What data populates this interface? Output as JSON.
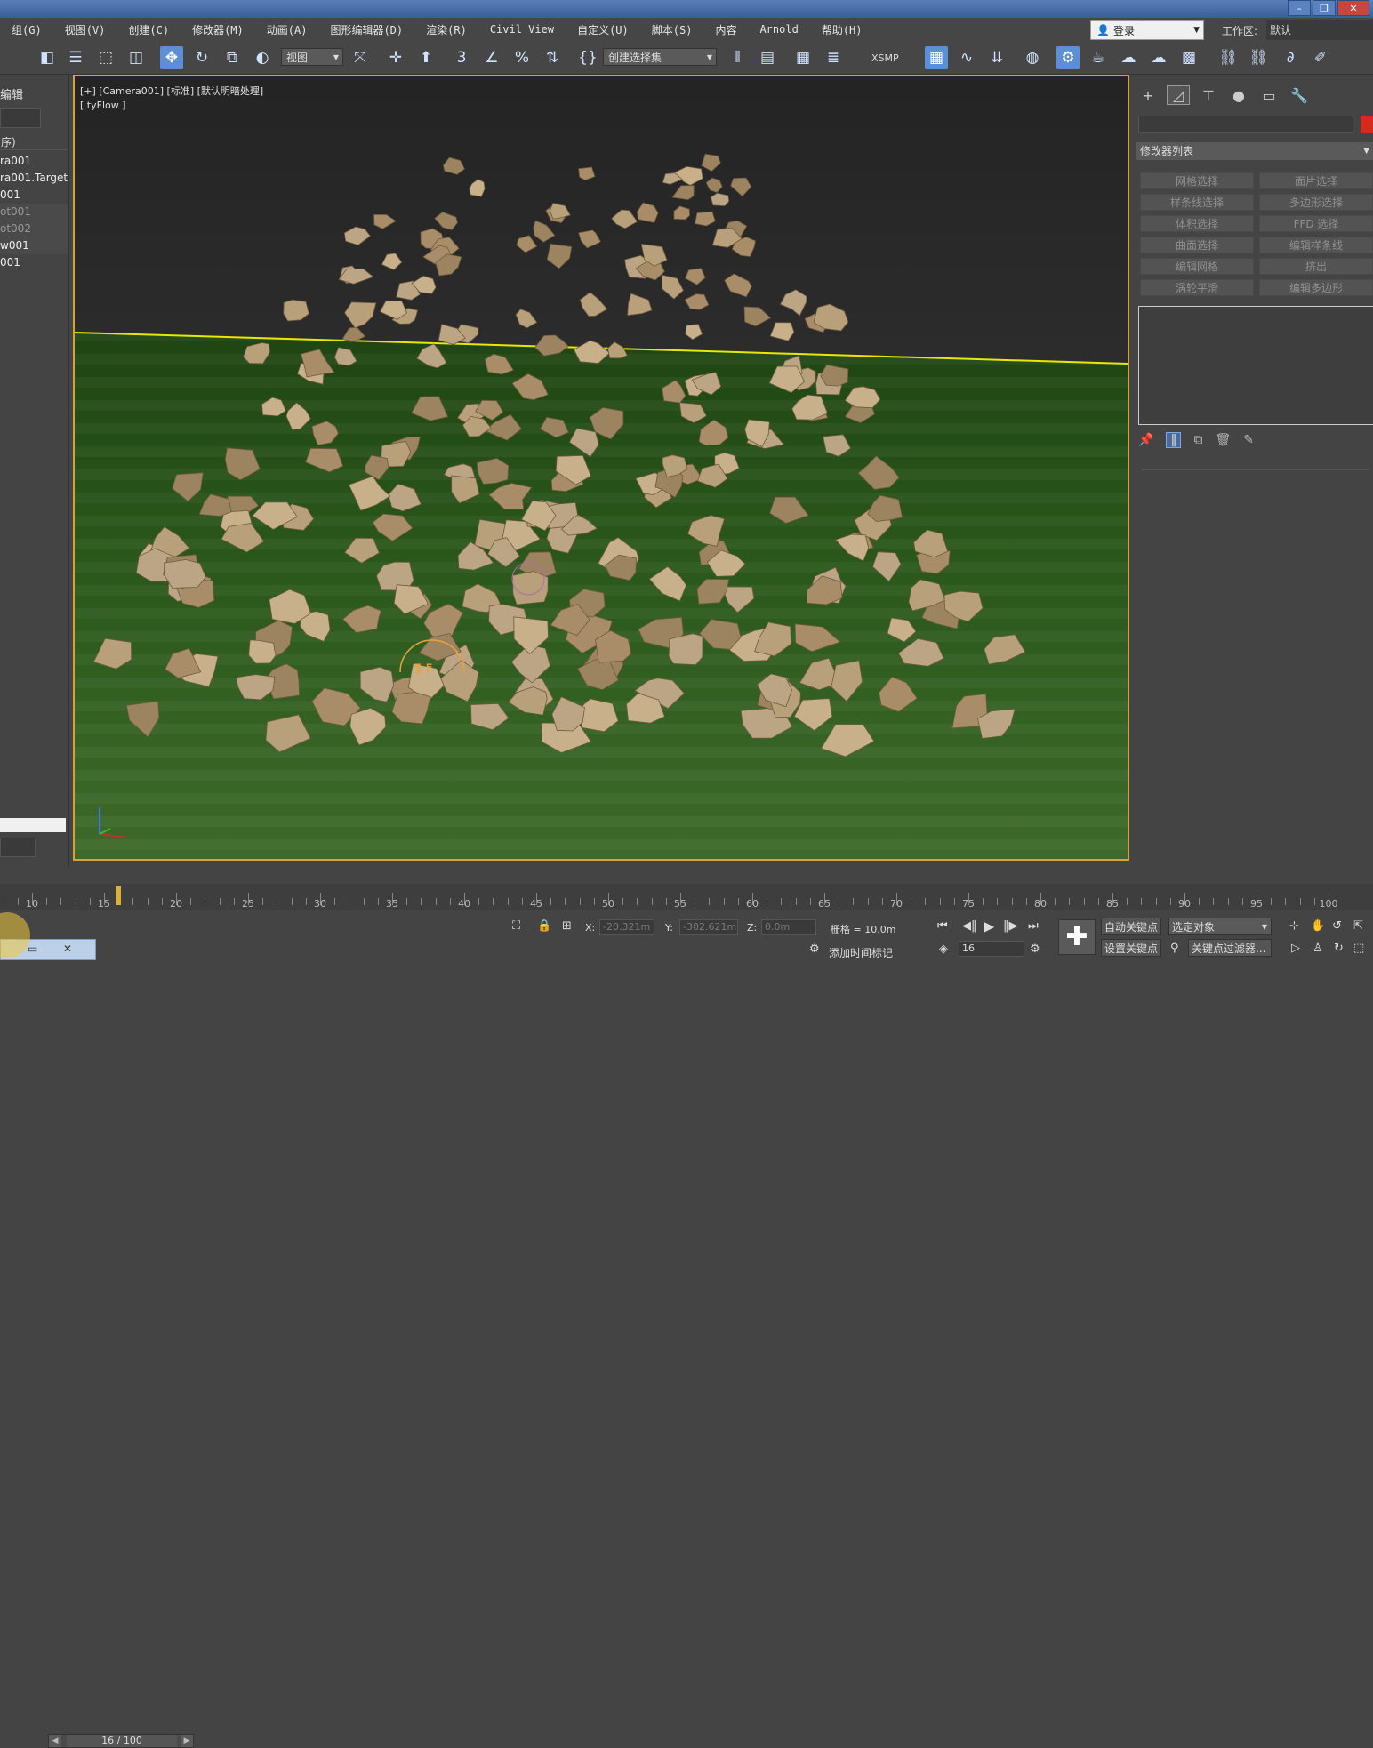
{
  "menu": [
    "组(G)",
    "视图(V)",
    "创建(C)",
    "修改器(M)",
    "动画(A)",
    "图形编辑器(D)",
    "渲染(R)",
    "Civil View",
    "自定义(U)",
    "脚本(S)",
    "内容",
    "Arnold",
    "帮助(H)"
  ],
  "login": {
    "label": "登录"
  },
  "workspace": {
    "label": "工作区:",
    "value": "默认"
  },
  "toolbar": {
    "view_select": "视图",
    "selection_set": "创建选择集",
    "xsmp": "XSMP"
  },
  "scene_explorer": {
    "title": "编辑",
    "column": "序)",
    "items": [
      "ra001",
      "ra001.Target",
      "001",
      "ot001",
      "ot002",
      "w001",
      "001"
    ]
  },
  "viewport": {
    "label_line1": "[+] [Camera001] [标准] [默认明暗处理]",
    "label_line2": "[ tyFlow ]"
  },
  "command_panel": {
    "modifier_list": "修改器列表",
    "modifier_buttons": [
      "网格选择",
      "面片选择",
      "样条线选择",
      "多边形选择",
      "体积选择",
      "FFD 选择",
      "曲面选择",
      "编辑样条线",
      "编辑网格",
      "挤出",
      "涡轮平滑",
      "编辑多边形"
    ]
  },
  "time_slider": {
    "label": "16 / 100",
    "current_frame": 16,
    "total_frames": 100
  },
  "timeline": {
    "ticks": [
      "10",
      "15",
      "20",
      "25",
      "30",
      "35",
      "40",
      "45",
      "50",
      "55",
      "60",
      "65",
      "70",
      "75",
      "80",
      "85",
      "90",
      "95",
      "100"
    ]
  },
  "status": {
    "x_label": "X:",
    "x_value": "-20.321m",
    "y_label": "Y:",
    "y_value": "-302.621m",
    "z_label": "Z:",
    "z_value": "0.0m",
    "grid": "栅格 = 10.0m",
    "add_time_tag": "添加时间标记",
    "auto_key": "自动关键点",
    "set_key": "设置关键点",
    "selected_object": "选定对象",
    "key_filters": "关键点过滤器...",
    "frame_field": "16"
  },
  "colors": {
    "viewport_border": "#d4a437",
    "horizon_line": "#e8e800",
    "ground": "#2e5a1e",
    "rock": "#b8a07a",
    "active_tool": "#5d8fd6"
  }
}
